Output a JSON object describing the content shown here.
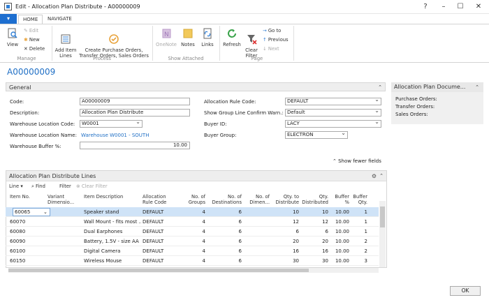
{
  "window": {
    "title": "Edit - Allocation Plan Distribute - A00000009",
    "help": "?",
    "minimize": "–",
    "maximize": "☐",
    "close": "✕"
  },
  "ribbon": {
    "file_label": "▾",
    "tabs": [
      {
        "label": "HOME"
      },
      {
        "label": "NAVIGATE"
      }
    ],
    "manage": {
      "view": "View",
      "edit": "Edit",
      "new": "New",
      "delete": "Delete",
      "group": "Manage"
    },
    "process": {
      "add_item_lines": "Add Item\nLines",
      "create_orders": "Create Purchase Orders,\nTransfer Orders, Sales Orders",
      "group": "Process"
    },
    "show_attached": {
      "onenote": "OneNote",
      "notes": "Notes",
      "links": "Links",
      "group": "Show Attached"
    },
    "page": {
      "refresh": "Refresh",
      "clear_filter": "Clear\nFilter",
      "go_to": "Go to",
      "previous": "Previous",
      "next": "Next",
      "group": "Page"
    }
  },
  "record_id": "A00000009",
  "general": {
    "header": "General",
    "code_label": "Code:",
    "code": "A00000009",
    "description_label": "Description:",
    "description": "Allocation Plan Distribute",
    "wh_loc_code_label": "Warehouse Location Code:",
    "wh_loc_code": "W0001",
    "wh_loc_name_label": "Warehouse Location Name:",
    "wh_loc_name": "Warehouse W0001 - SOUTH",
    "wh_buffer_label": "Warehouse Buffer %:",
    "wh_buffer": "10.00",
    "alloc_rule_label": "Allocation Rule Code:",
    "alloc_rule": "DEFAULT",
    "show_group_label": "Show Group Line Confirm Warn.:",
    "show_group": "Default",
    "buyer_id_label": "Buyer ID:",
    "buyer_id": "LACY",
    "buyer_group_label": "Buyer Group:",
    "buyer_group": "ELECTRON",
    "show_fewer": "Show fewer fields"
  },
  "factbox": {
    "header": "Allocation Plan Docume...",
    "purchase": "Purchase Orders:",
    "transfer": "Transfer Orders:",
    "sales": "Sales Orders:"
  },
  "lines": {
    "header": "Allocation Plan Distribute Lines",
    "toolbar": {
      "line": "Line",
      "find": "Find",
      "filter": "Filter",
      "clear_filter": "Clear Filter"
    },
    "columns": [
      {
        "label": "Item No."
      },
      {
        "label": "Variant\nDimensio..."
      },
      {
        "label": "Item Description"
      },
      {
        "label": "Allocation\nRule Code"
      },
      {
        "label": "No. of\nGroups"
      },
      {
        "label": "No. of\nDestinations"
      },
      {
        "label": "No. of\nDimen..."
      },
      {
        "label": "Qty. to\nDistribute"
      },
      {
        "label": "Qty.\nDistributed"
      },
      {
        "label": "Buffer\n%"
      },
      {
        "label": "Buffer\nQty."
      }
    ],
    "rows": [
      {
        "item": "60065",
        "variant": "",
        "desc": "Speaker stand",
        "rule": "DEFAULT",
        "groups": "4",
        "dest": "6",
        "dimen": "",
        "qty": "10",
        "dist": "10",
        "buf": "10.00",
        "bufqty": "1"
      },
      {
        "item": "60070",
        "variant": "",
        "desc": "Wall Mount - fits most ...",
        "rule": "DEFAULT",
        "groups": "4",
        "dest": "6",
        "dimen": "",
        "qty": "12",
        "dist": "12",
        "buf": "10.00",
        "bufqty": "1"
      },
      {
        "item": "60080",
        "variant": "",
        "desc": "Dual Earphones",
        "rule": "DEFAULT",
        "groups": "4",
        "dest": "6",
        "dimen": "",
        "qty": "6",
        "dist": "6",
        "buf": "10.00",
        "bufqty": "1"
      },
      {
        "item": "60090",
        "variant": "",
        "desc": "Battery, 1.5V - size AA",
        "rule": "DEFAULT",
        "groups": "4",
        "dest": "6",
        "dimen": "",
        "qty": "20",
        "dist": "20",
        "buf": "10.00",
        "bufqty": "2"
      },
      {
        "item": "60100",
        "variant": "",
        "desc": "Digital Camera",
        "rule": "DEFAULT",
        "groups": "4",
        "dest": "6",
        "dimen": "",
        "qty": "16",
        "dist": "16",
        "buf": "10.00",
        "bufqty": "2"
      },
      {
        "item": "60150",
        "variant": "",
        "desc": "Wireless Mouse",
        "rule": "DEFAULT",
        "groups": "4",
        "dest": "6",
        "dimen": "",
        "qty": "30",
        "dist": "30",
        "buf": "10.00",
        "bufqty": "3"
      }
    ]
  },
  "ok": "OK"
}
